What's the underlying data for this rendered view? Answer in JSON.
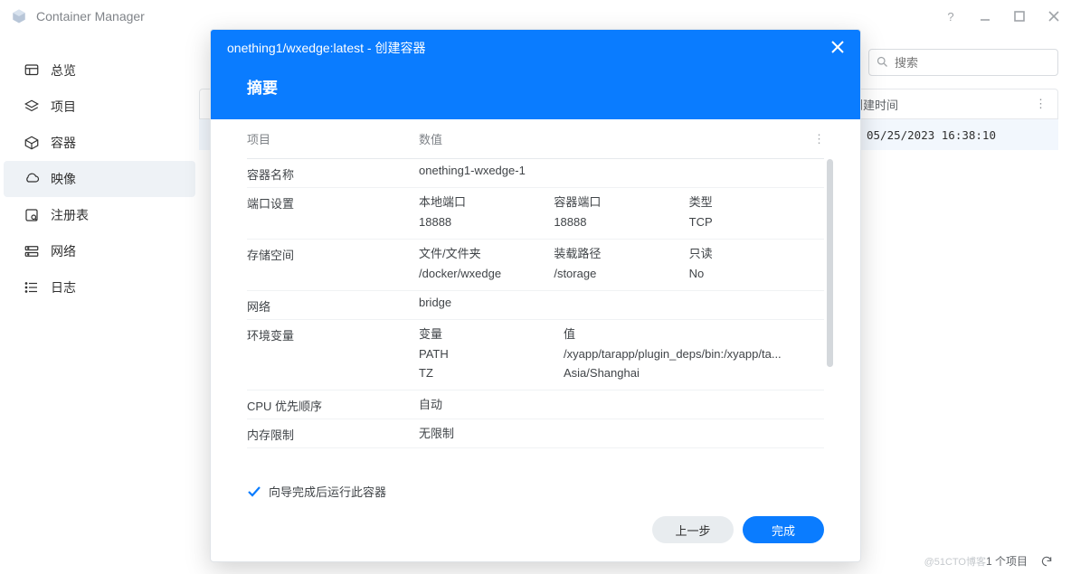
{
  "app": {
    "title": "Container Manager"
  },
  "sidebar": {
    "items": [
      {
        "label": "总览"
      },
      {
        "label": "项目"
      },
      {
        "label": "容器"
      },
      {
        "label": "映像"
      },
      {
        "label": "注册表"
      },
      {
        "label": "网络"
      },
      {
        "label": "日志"
      }
    ]
  },
  "search": {
    "placeholder": "搜索"
  },
  "table": {
    "col_created": "创建时间",
    "row_created": "05/25/2023 16:38:10"
  },
  "footer": {
    "count": "1 个项目"
  },
  "watermark": "@51CTO博客",
  "modal": {
    "title": "onething1/wxedge:latest - 创建容器",
    "subtitle": "摘要",
    "head_c1": "项目",
    "head_c2": "数值",
    "rows": {
      "cname_label": "容器名称",
      "cname_value": "onething1-wxedge-1",
      "port_label": "端口设置",
      "port_h1": "本地端口",
      "port_h2": "容器端口",
      "port_h3": "类型",
      "port_v1": "18888",
      "port_v2": "18888",
      "port_v3": "TCP",
      "vol_label": "存储空间",
      "vol_h1": "文件/文件夹",
      "vol_h2": "装载路径",
      "vol_h3": "只读",
      "vol_v1": "/docker/wxedge",
      "vol_v2": "/storage",
      "vol_v3": "No",
      "net_label": "网络",
      "net_value": "bridge",
      "env_label": "环境变量",
      "env_h1": "变量",
      "env_h2": "值",
      "env_r1_k": "PATH",
      "env_r1_v": "/xyapp/tarapp/plugin_deps/bin:/xyapp/ta...",
      "env_r2_k": "TZ",
      "env_r2_v": "Asia/Shanghai",
      "cpu_label": "CPU 优先顺序",
      "cpu_value": "自动",
      "mem_label": "内存限制",
      "mem_value": "无限制"
    },
    "checkbox_label": "向导完成后运行此容器",
    "btn_prev": "上一步",
    "btn_done": "完成"
  }
}
